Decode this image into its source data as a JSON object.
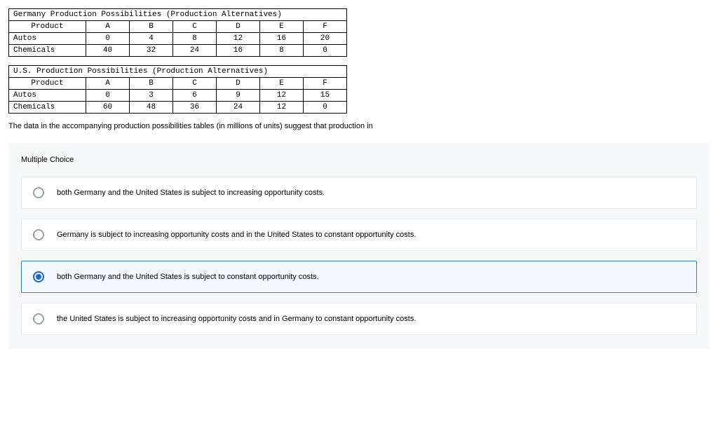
{
  "tables": [
    {
      "title": "Germany Production Possibilities (Production Alternatives)",
      "header": [
        "Product",
        "A",
        "B",
        "C",
        "D",
        "E",
        "F"
      ],
      "rows": [
        {
          "label": "Autos",
          "values": [
            "0",
            "4",
            "8",
            "12",
            "16",
            "20"
          ]
        },
        {
          "label": "Chemicals",
          "values": [
            "40",
            "32",
            "24",
            "16",
            "8",
            "0"
          ]
        }
      ]
    },
    {
      "title": "U.S. Production Possibilities (Production Alternatives)",
      "header": [
        "Product",
        "A",
        "B",
        "C",
        "D",
        "E",
        "F"
      ],
      "rows": [
        {
          "label": "Autos",
          "values": [
            "0",
            "3",
            "6",
            "9",
            "12",
            "15"
          ]
        },
        {
          "label": "Chemicals",
          "values": [
            "60",
            "48",
            "36",
            "24",
            "12",
            "0"
          ]
        }
      ]
    }
  ],
  "question": "The data in the accompanying production possibilities tables (in millions of units) suggest that production in",
  "mc_label": "Multiple Choice",
  "choices": [
    {
      "text": "both Germany and the United States is subject to increasing opportunity costs.",
      "selected": false
    },
    {
      "text": "Germany is subject to increasing opportunity costs and in the United States to constant opportunity costs.",
      "selected": false
    },
    {
      "text": "both Germany and the United States is subject to constant opportunity costs.",
      "selected": true
    },
    {
      "text": "the United States is subject to increasing opportunity costs and in Germany to constant opportunity costs.",
      "selected": false
    }
  ]
}
